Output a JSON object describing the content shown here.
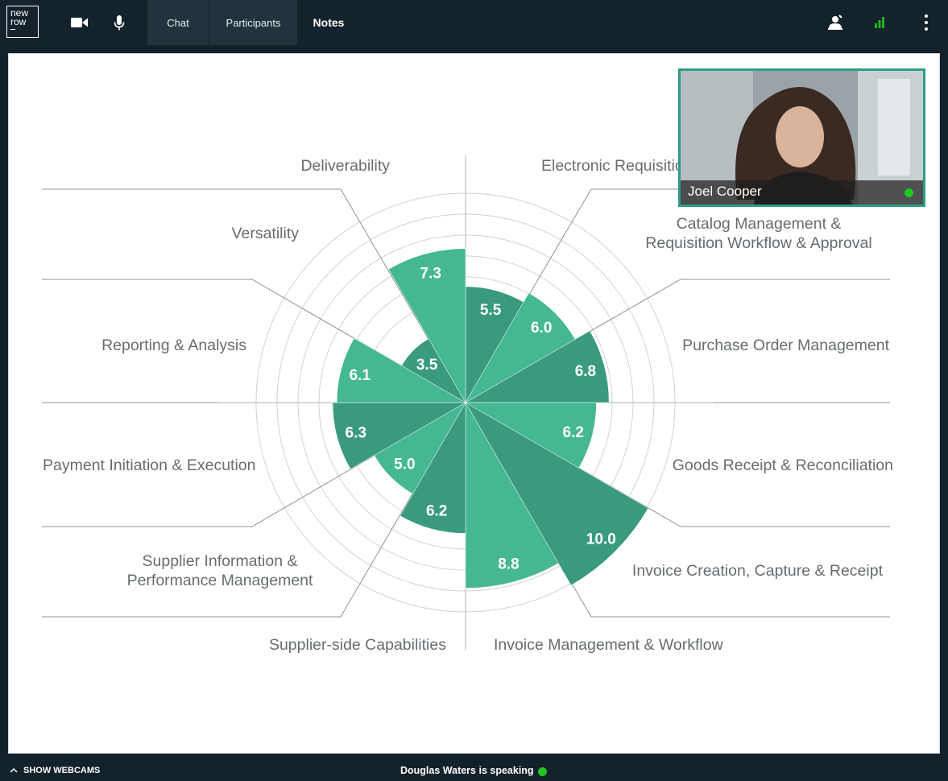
{
  "app": {
    "logo_line1": "new",
    "logo_line2": "row"
  },
  "toolbar": {
    "tabs": [
      "Chat",
      "Participants",
      "Notes"
    ],
    "signal_color": "#22b322"
  },
  "webcam": {
    "name": "Joel Cooper",
    "status_color": "#1ec91e"
  },
  "footer": {
    "show_webcams": "SHOW WEBCAMS",
    "speaking": "Douglas Waters is speaking"
  },
  "chart_data": {
    "type": "polar-area",
    "categories": [
      "Electronic Requisition",
      "Catalog Management & Requisition Workflow & Approval",
      "Purchase Order Management",
      "Goods Receipt & Reconciliation",
      "Invoice Creation, Capture & Receipt",
      "Invoice Management & Workflow",
      "Supplier-side Capabilities",
      "Supplier Information & Performance Management",
      "Payment Initiation & Execution",
      "Reporting & Analysis",
      "Versatility",
      "Deliverability"
    ],
    "values": [
      5.5,
      6.0,
      6.8,
      6.2,
      10.0,
      8.8,
      6.2,
      5.0,
      6.3,
      6.1,
      3.5,
      7.3
    ],
    "rmax": 10,
    "rings": 6,
    "colors": {
      "light": "#45b893",
      "dark": "#3a9a7e"
    }
  }
}
